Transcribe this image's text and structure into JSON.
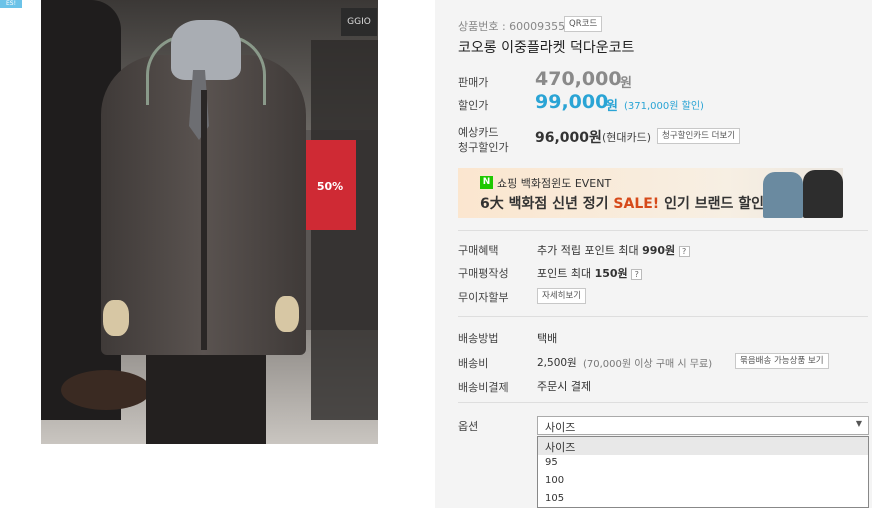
{
  "corner_badge": "ES!",
  "photo": {
    "sign_text": "50%",
    "brand_sign": "GGIO"
  },
  "product": {
    "code_label": "상품번호 : 600093554",
    "qr_button": "QR코드",
    "title": "코오롱 이중플라켓 덕다운코트"
  },
  "prices": {
    "list_label": "판매가",
    "list_price": "470,000",
    "list_won": "원",
    "sale_label": "할인가",
    "sale_price": "99,000",
    "sale_won": "원",
    "discount_note": "(371,000원 할인)",
    "card_label_1": "예상카드",
    "card_label_2": "청구할인가",
    "card_price": "96,000원",
    "card_name": "(현대카드)",
    "card_button": "청구할인카드 더보기"
  },
  "banner": {
    "logo": "N",
    "line1": "쇼핑 백화점윈도 EVENT",
    "line2_a": "6大 백화점 신년 정기 ",
    "line2_b": "SALE!",
    "line2_c": " 인기 브랜드 할인"
  },
  "benefits": {
    "label_1": "구매혜택",
    "text_1_a": "추가 적립 포인트 최대 ",
    "text_1_b": "990원",
    "label_2": "구매평작성",
    "text_2_a": "포인트 최대 ",
    "text_2_b": "150원",
    "label_3": "무이자할부",
    "button_3": "자세히보기",
    "help_icon": "?"
  },
  "shipping": {
    "method_label": "배송방법",
    "method_value": "택배",
    "fee_label": "배송비",
    "fee_value": "2,500원",
    "fee_note": "(70,000원 이상 구매 시 무료)",
    "fee_button": "묶음배송 가능상품 보기",
    "pay_label": "배송비결제",
    "pay_value": "주문시 결제"
  },
  "option": {
    "label": "옵션",
    "selected": "사이즈",
    "caret": "▼",
    "options": [
      "사이즈",
      "95",
      "100",
      "105"
    ]
  }
}
